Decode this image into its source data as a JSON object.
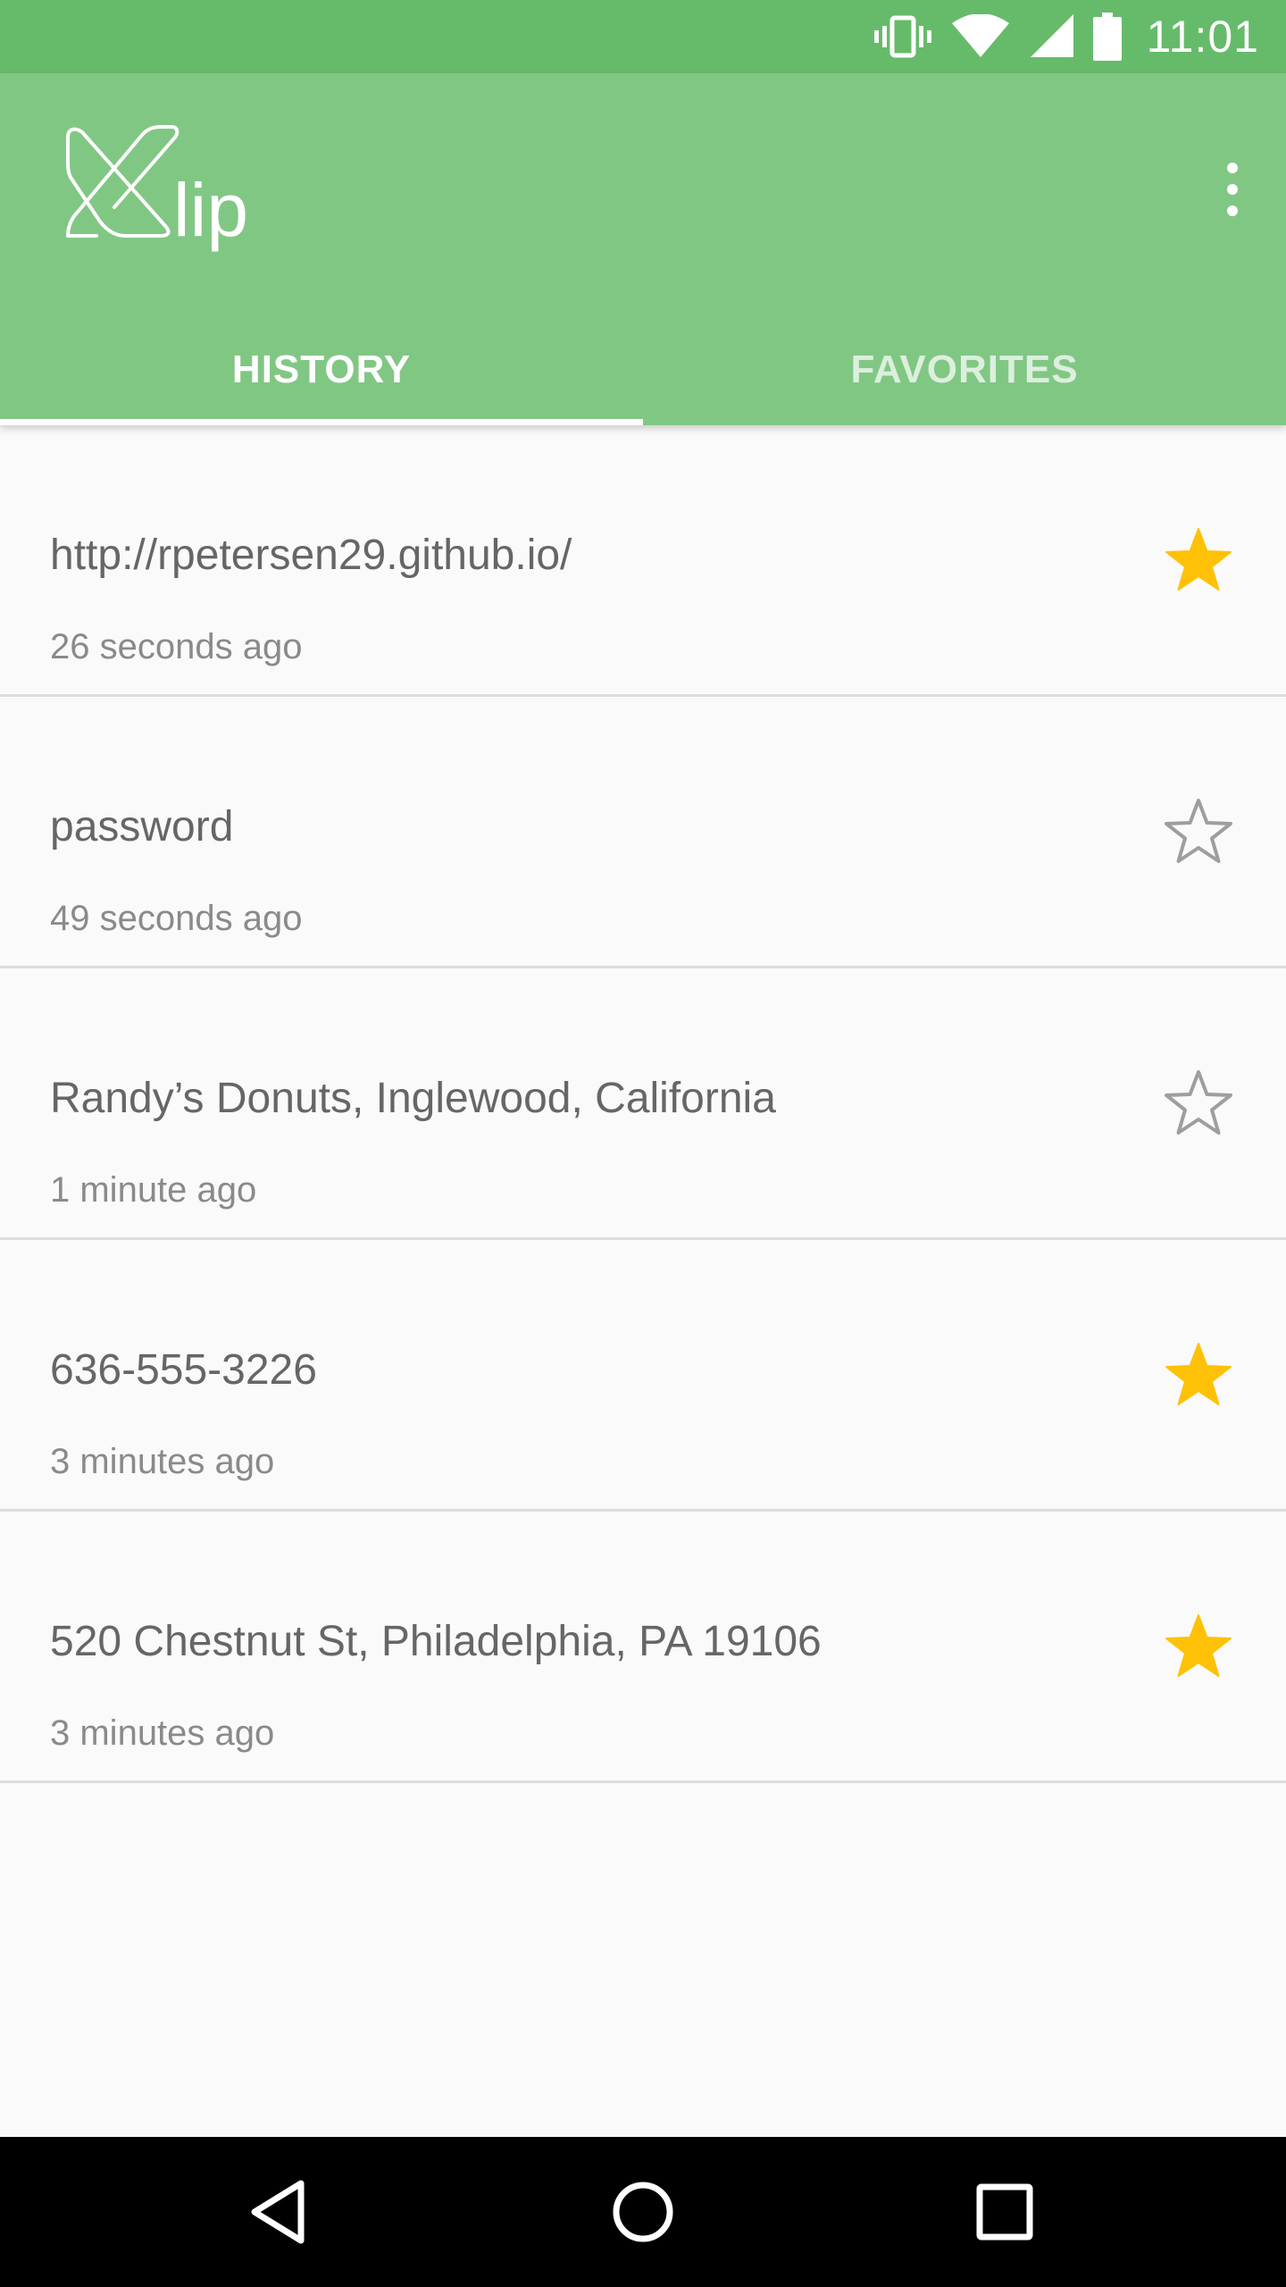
{
  "status_bar": {
    "time": "11:01",
    "icons": [
      "vibrate-icon",
      "wifi-icon",
      "signal-icon",
      "battery-icon"
    ],
    "background": "#66bb6a"
  },
  "app_bar": {
    "logo_text": "lip",
    "background": "#81c784",
    "menu_icon": "overflow-menu-icon"
  },
  "tabs": [
    {
      "label": "HISTORY",
      "active": true
    },
    {
      "label": "FAVORITES",
      "active": false
    }
  ],
  "history": [
    {
      "text": "http://rpetersen29.github.io/",
      "time": "26 seconds ago",
      "favorite": true
    },
    {
      "text": "password",
      "time": "49 seconds ago",
      "favorite": false
    },
    {
      "text": "Randy’s Donuts, Inglewood, California",
      "time": "1 minute ago",
      "favorite": false
    },
    {
      "text": "636-555-3226",
      "time": "3 minutes ago",
      "favorite": true
    },
    {
      "text": "520 Chestnut St, Philadelphia, PA 19106",
      "time": "3 minutes ago",
      "favorite": true
    }
  ],
  "colors": {
    "star_filled": "#ffc107",
    "star_outline": "#9e9e9e"
  },
  "nav_bar": {
    "icons": [
      "back-icon",
      "home-icon",
      "recents-icon"
    ]
  }
}
